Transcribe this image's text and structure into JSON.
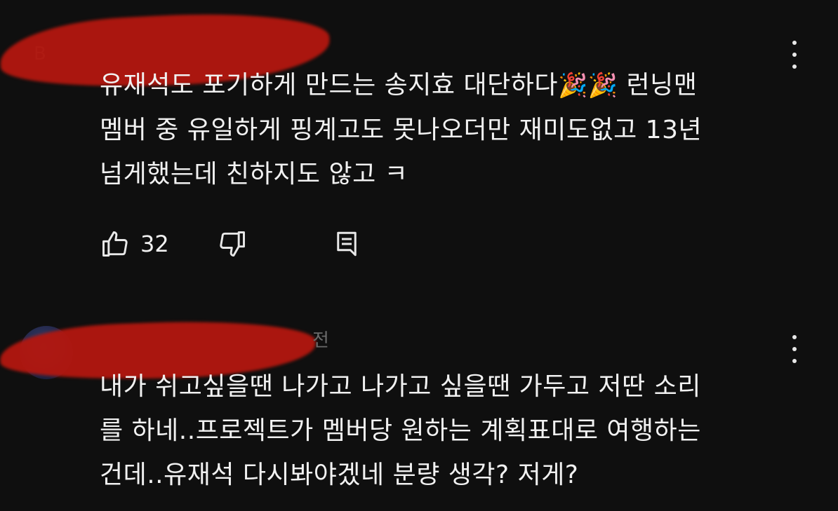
{
  "comments": [
    {
      "author_redacted": "B",
      "text_lines": [
        "유재석도 포기하게 만드는 송지효 대단하다",
        "멤버 중 유일하게 핑계고도 못나오더만 재미도없고 13년",
        "넘게했는데 친하지도 않고 ㅋ"
      ],
      "emoji": "🎉🎉",
      "after_emoji": " 런닝맨",
      "likes": "32",
      "icons": {
        "like": "thumbs-up-icon",
        "dislike": "thumbs-down-icon",
        "reply": "reply-icon",
        "menu": "more-vert-icon"
      }
    },
    {
      "author_redacted": "전",
      "text_lines": [
        "내가 쉬고싶을땐 나가고 나가고 싶을땐 가두고 저딴 소리",
        "를 하네..프로젝트가 멤버당 원하는 계획표대로 여행하는",
        "건데..유재석 다시봐야겠네 분량 생각? 저게?"
      ],
      "icons": {
        "menu": "more-vert-icon"
      }
    }
  ],
  "colors": {
    "background": "#0f0f0f",
    "text": "#f1f1f1",
    "redaction": "#b3170f"
  }
}
